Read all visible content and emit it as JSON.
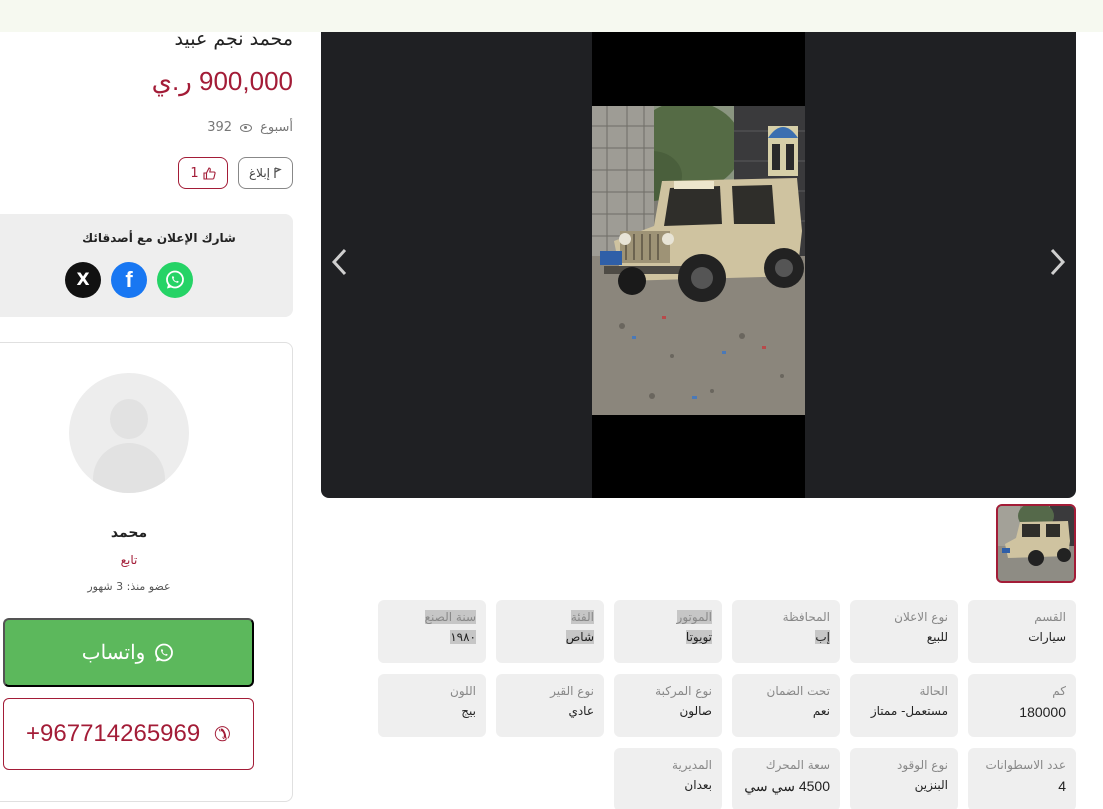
{
  "listing": {
    "title": "محمد نجم عبيد",
    "price": "900,000 ر.ي",
    "views": "392",
    "posted": "أسبوع",
    "report_label": "إبلاغ",
    "likes": "1"
  },
  "share": {
    "title": "شارك الإعلان مع أصدقائك",
    "x_icon": "X",
    "fb_icon": "f"
  },
  "seller": {
    "name": "محمد",
    "follow_label": "تابع",
    "member_since": "عضو منذ: 3 شهور",
    "whatsapp_label": "واتساب",
    "phone": "+967714265969"
  },
  "gallery": {
    "prev_arrow": "‹",
    "next_arrow": "›"
  },
  "specs": [
    {
      "label": "القسم",
      "value": "سيارات"
    },
    {
      "label": "نوع الاعلان",
      "value": "للبيع"
    },
    {
      "label": "المحافظة",
      "value": "إب"
    },
    {
      "label": "الموتور",
      "value": "تويوتا"
    },
    {
      "label": "الفئة",
      "value": "شاص"
    },
    {
      "label": "سنة الصنع",
      "value": "١٩٨٠"
    },
    {
      "label": "كم",
      "value": "180000"
    },
    {
      "label": "الحالة",
      "value": "مستعمل- ممتاز"
    },
    {
      "label": "تحت الضمان",
      "value": "نعم"
    },
    {
      "label": "نوع المركبة",
      "value": "صالون"
    },
    {
      "label": "نوع القير",
      "value": "عادي"
    },
    {
      "label": "اللون",
      "value": "بيج"
    },
    {
      "label": "عدد الاسطوانات",
      "value": "4"
    },
    {
      "label": "نوع الوقود",
      "value": "البنزين"
    },
    {
      "label": "سعة المحرك",
      "value": "4500 سي سي"
    },
    {
      "label": "المديرية",
      "value": "بعدان"
    }
  ],
  "colors": {
    "brand": "#a31c37",
    "whatsapp": "#5cb85c",
    "gallery_bg": "#1f2023"
  },
  "icons": [
    "eye-icon",
    "flag-icon",
    "thumbs-up-icon",
    "x-icon",
    "facebook-icon",
    "whatsapp-icon",
    "phone-icon",
    "chevron-left-icon",
    "chevron-right-icon"
  ]
}
